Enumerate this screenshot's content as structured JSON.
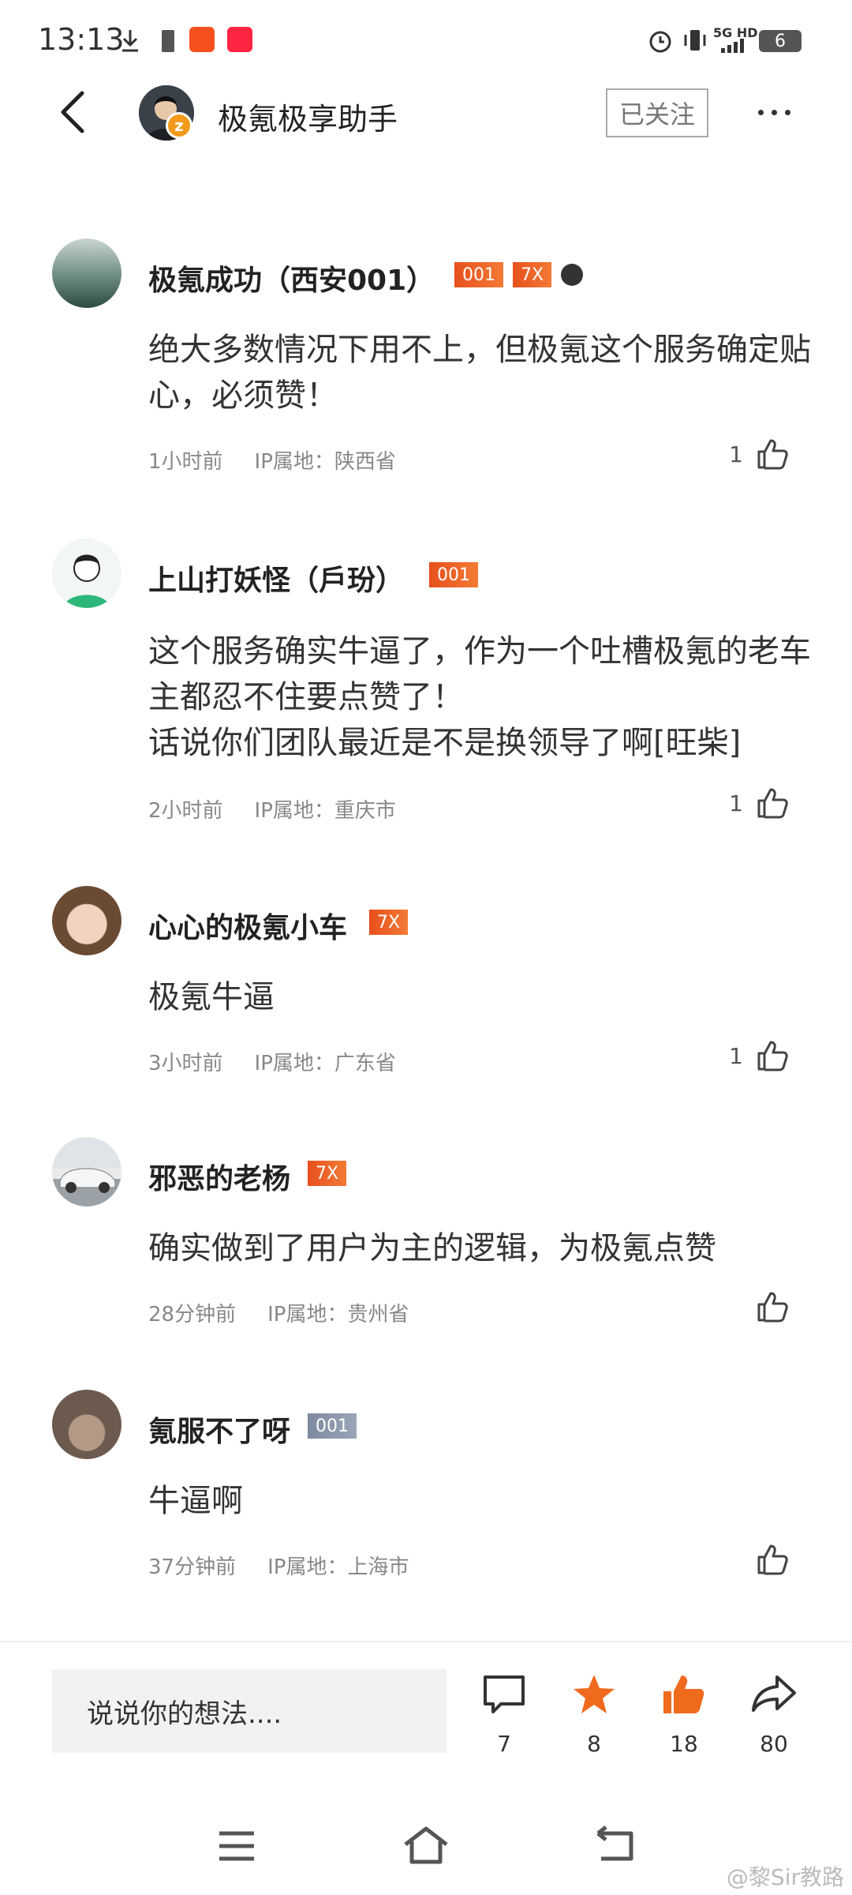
{
  "status": {
    "time": "13:13",
    "network": "5G HD",
    "battery": "6"
  },
  "header": {
    "title": "极氪极享助手",
    "follow_label": "已关注"
  },
  "comments": [
    {
      "name": "极氪成功（西安001）",
      "badges": [
        "001",
        "7X"
      ],
      "text": "绝大多数情况下用不上，但极氪这个服务确定贴心，必须赞！",
      "time": "1小时前",
      "ip": "IP属地：陕西省",
      "likes": "1"
    },
    {
      "name": "上山打妖怪（戶玢）",
      "badges": [
        "001"
      ],
      "text": "这个服务确实牛逼了，作为一个吐槽极氪的老车主都忍不住要点赞了！\n话说你们团队最近是不是换领导了啊[旺柴]",
      "time": "2小时前",
      "ip": "IP属地：重庆市",
      "likes": "1"
    },
    {
      "name": "心心的极氪小车",
      "badges": [
        "7X"
      ],
      "text": "极氪牛逼",
      "time": "3小时前",
      "ip": "IP属地：广东省",
      "likes": "1"
    },
    {
      "name": "邪恶的老杨",
      "badges": [
        "7X"
      ],
      "text": "确实做到了用户为主的逻辑，为极氪点赞",
      "time": "28分钟前",
      "ip": "IP属地：贵州省",
      "likes": ""
    },
    {
      "name": "氪服不了呀",
      "badges": [
        "001"
      ],
      "text": "牛逼啊",
      "time": "37分钟前",
      "ip": "IP属地：上海市",
      "likes": ""
    }
  ],
  "bottom": {
    "placeholder": "说说你的想法....",
    "comment_count": "7",
    "favorite_count": "8",
    "like_count": "18",
    "share_count": "80"
  },
  "watermark": "@黎Sir教路",
  "colors": {
    "accent": "#f06a1e",
    "badge_gray": "#8593a8"
  },
  "icons": [
    "back-arrow-icon",
    "more-icon",
    "thumb-up-icon",
    "comment-icon",
    "star-icon",
    "share-icon",
    "menu-icon",
    "home-icon",
    "back-nav-icon"
  ]
}
